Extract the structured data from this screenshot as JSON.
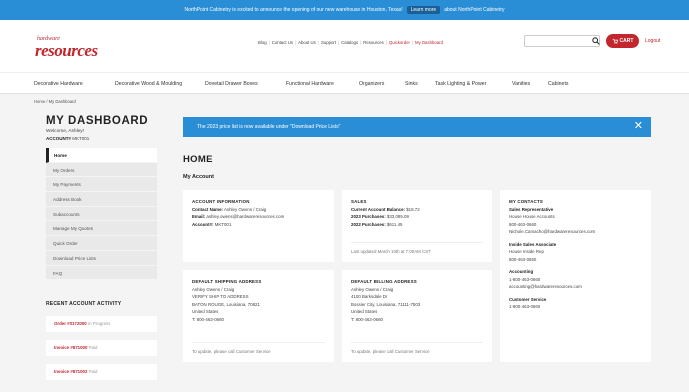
{
  "announcement": {
    "text_before": "NorthPoint Cabinetry is excited to announce the opening of our new warehouse in Houston, Texas!",
    "link": "Learn more",
    "text_after": "about NorthPoint Cabinetry"
  },
  "logo": {
    "small": "hardware",
    "big": "resources"
  },
  "top_links": [
    "Blog",
    "Contact Us",
    "About Us",
    "Support",
    "Catalogs",
    "Resources",
    "Quickorder",
    "My Dashboard"
  ],
  "search": {
    "placeholder": ""
  },
  "cart": {
    "label": "CART"
  },
  "login": {
    "label": "Logout"
  },
  "main_nav": [
    "Decorative Hardware",
    "Decorative Wood & Moulding",
    "Dovetail Drawer Boxes",
    "Functional Hardware",
    "Organizers",
    "Sinks",
    "Task Lighting & Power",
    "Vanities",
    "Cabinets"
  ],
  "breadcrumb": "Home / My Dashboard",
  "dashboard": {
    "title": "MY DASHBOARD",
    "welcome": "Welcome, Ashley!",
    "account_label": "ACCOUNT#",
    "account_number": "MKT001"
  },
  "sidebar": [
    {
      "label": "Home"
    },
    {
      "label": "My Orders"
    },
    {
      "label": "My Payments"
    },
    {
      "label": "Address Book"
    },
    {
      "label": "Subaccounts"
    },
    {
      "label": "Manage My Quotes"
    },
    {
      "label": "Quick Order"
    },
    {
      "label": "Download Price Lists"
    },
    {
      "label": "FAQ"
    }
  ],
  "recent": {
    "title": "RECENT ACCOUNT ACTIVITY",
    "items": [
      {
        "label": "Order #0172000",
        "status": "In Progress"
      },
      {
        "label": "Invoice #871000",
        "status": "Paid"
      },
      {
        "label": "Invoice #871002",
        "status": "Paid"
      }
    ]
  },
  "notice": {
    "text": "The 2023 price list is now available under \"Download Price Lists\"",
    "close": "✕"
  },
  "home": {
    "title": "HOME",
    "subtitle": "My Account"
  },
  "account_info": {
    "title": "ACCOUNT INFORMATION",
    "contact_label": "Contact Name:",
    "contact": "Ashley Owens / Craig",
    "email_label": "Email:",
    "email": "ashley.owens@hardwareresources.com",
    "account_label": "Account#:",
    "account": "MKT001"
  },
  "sales": {
    "title": "SALES",
    "balance_label": "Current Account Balance:",
    "balance": "$18.72",
    "p2023_label": "2023 Purchases:",
    "p2023": "$33,095.09",
    "p2022_label": "2022 Purchases:",
    "p2022": "$611.45",
    "updated": "Last updated March 10th at 7:00AM CST"
  },
  "contacts": {
    "title": "MY CONTACTS",
    "groups": [
      {
        "heading": "Sales Representative",
        "lines": [
          "House House Accounts",
          "800-463-0660",
          "Nichole.Camacho@hardwareresources.com"
        ]
      },
      {
        "heading": "Inside Sales Associate",
        "lines": [
          "House Inside Rep",
          "800-463-0660"
        ]
      },
      {
        "heading": "Accounting",
        "lines": [
          "1-800-463-0660",
          "accounting@hardwareresources.com"
        ]
      },
      {
        "heading": "Customer Service",
        "lines": [
          "1-800-463-0660"
        ]
      }
    ]
  },
  "shipping": {
    "title": "DEFAULT SHIPPING ADDRESS",
    "lines": [
      "Ashley Owens / Craig",
      "VERIFY SHIP TO ADDRESS",
      "BATON ROUGE, Louisiana, 70821",
      "United States",
      "T: 800-463-0660"
    ],
    "footer": "To update, please call Customer Service"
  },
  "billing": {
    "title": "DEFAULT BILLING ADDRESS",
    "lines": [
      "Ashley Owens / Craig",
      "4100 Barksdale Dr",
      "Bossier City, Louisiana, 71111-7503",
      "United States",
      "T: 800-463-0660"
    ],
    "footer": "To update, please call Customer Service"
  },
  "colors": {
    "brand_red": "#c1272d",
    "accent_blue": "#2a8ed6"
  }
}
